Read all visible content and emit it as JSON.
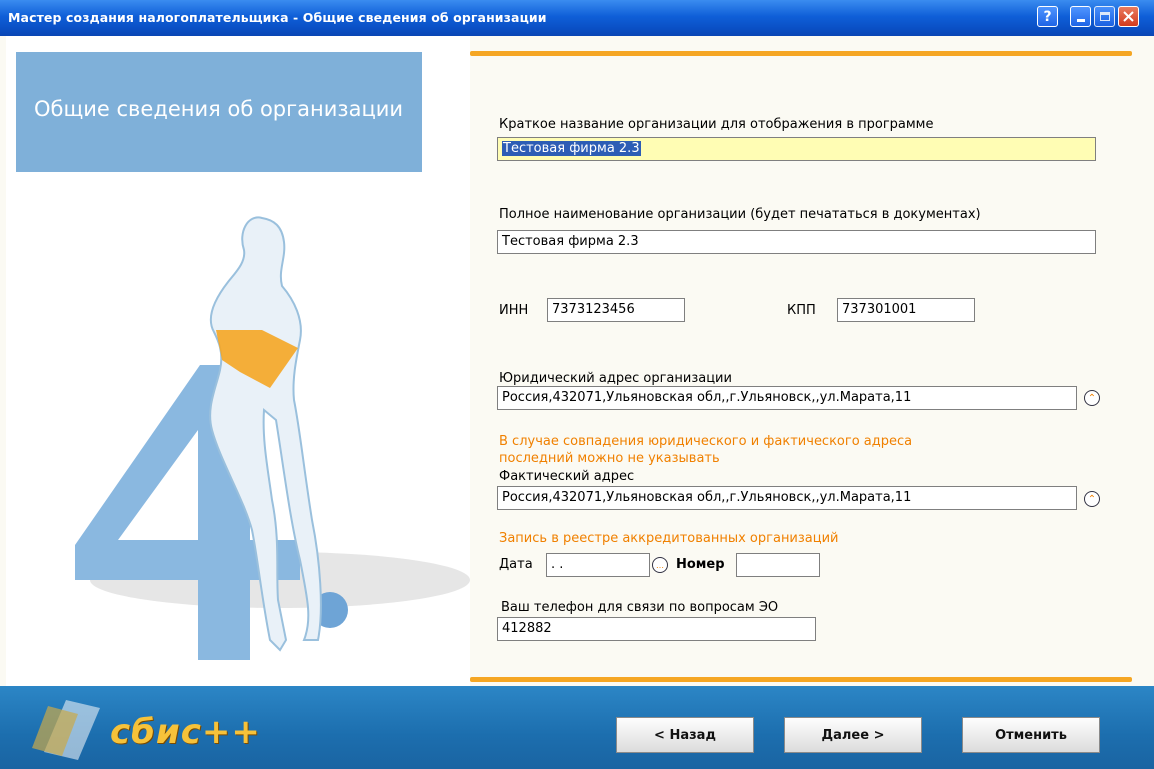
{
  "window": {
    "title": "Мастер создания налогоплательщика - Общие сведения об организации",
    "help_label": "?"
  },
  "left_panel": {
    "header": "Общие сведения об организации"
  },
  "form": {
    "short_name_label": "Краткое название организации для отображения в программе",
    "short_name_value": "Тестовая фирма 2.3",
    "full_name_label": "Полное наименование организации (будет печататься в документах)",
    "full_name_value": "Тестовая фирма 2.3",
    "inn_label": "ИНН",
    "inn_value": "7373123456",
    "kpp_label": "КПП",
    "kpp_value": "737301001",
    "legal_address_label": "Юридический адрес организации",
    "legal_address_value": "Россия,432071,Ульяновская обл,,г.Ульяновск,,ул.Марата,11",
    "address_note_line1": "В случае совпадения юридического и фактического адреса",
    "address_note_line2": "последний можно не указывать",
    "actual_address_label": "Фактический адрес",
    "actual_address_value": "Россия,432071,Ульяновская обл,,г.Ульяновск,,ул.Марата,11",
    "registry_label": "Запись в реестре аккредитованных организаций",
    "date_label": "Дата",
    "date_value": " . .",
    "number_label": "Номер",
    "number_value": "",
    "phone_label": "Ваш телефон для связи по вопросам ЭО",
    "phone_value": "412882"
  },
  "footer": {
    "logo": "сбис++",
    "back_label": "< Назад",
    "next_label": "Далее >",
    "cancel_label": "Отменить"
  },
  "colors": {
    "accent_orange": "#f5a623",
    "header_blue": "#7fb0d9",
    "footer_blue": "#1c6eae"
  }
}
